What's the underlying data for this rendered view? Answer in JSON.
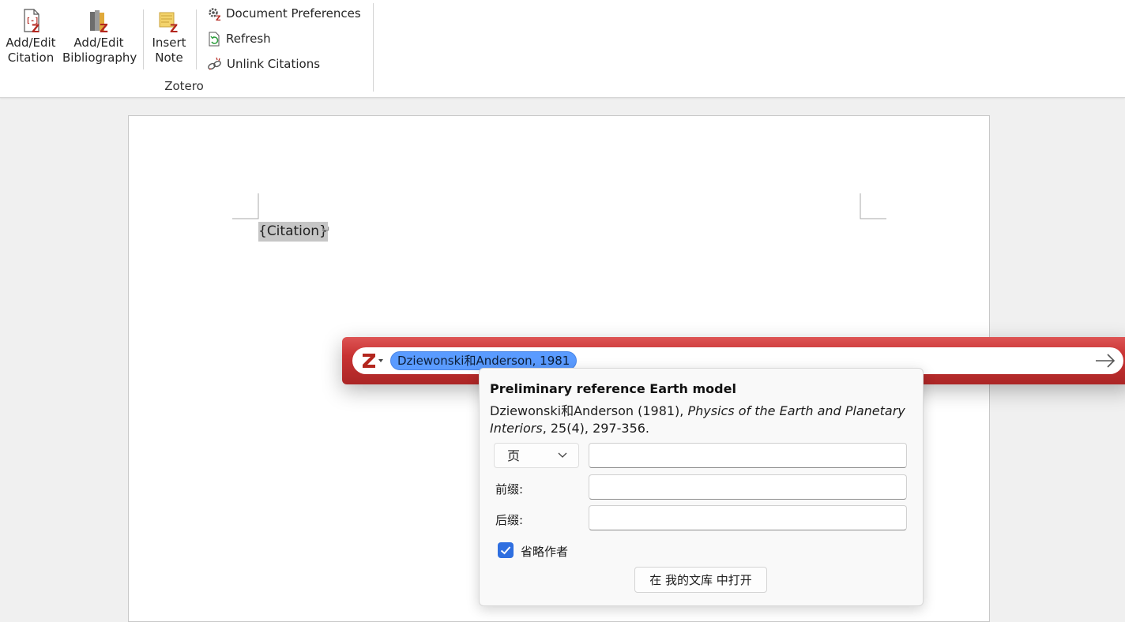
{
  "ribbon": {
    "add_edit_citation": [
      "Add/Edit",
      "Citation"
    ],
    "add_edit_bibliography": [
      "Add/Edit",
      "Bibliography"
    ],
    "insert_note": [
      "Insert",
      "Note"
    ],
    "document_preferences": "Document Preferences",
    "refresh": "Refresh",
    "unlink_citations": "Unlink Citations",
    "group_label": "Zotero"
  },
  "document": {
    "citation_field": "{Citation}",
    "paragraph_mark": "↵"
  },
  "quick_format": {
    "citation_bubble": "Dziewonski和Anderson, 1981",
    "icons": [
      "zotero-logo-icon",
      "dropdown-caret-icon",
      "accept-arrow-icon"
    ],
    "bar_color": "#c83232",
    "bubble_color": "#5a9bff"
  },
  "panel": {
    "title": "Preliminary reference Earth model",
    "citation_authors": "Dziewonski和Anderson (1981), ",
    "citation_journal": "Physics of the Earth and Planetary Interiors",
    "citation_rest": ", 25(4), 297-356.",
    "locator_selected": "页",
    "locator_value": "",
    "prefix_label": "前缀:",
    "prefix_value": "",
    "suffix_label": "后缀:",
    "suffix_value": "",
    "omit_author_label": "省略作者",
    "omit_author_checked": true,
    "open_in_library": "在 我的文库 中打开"
  }
}
